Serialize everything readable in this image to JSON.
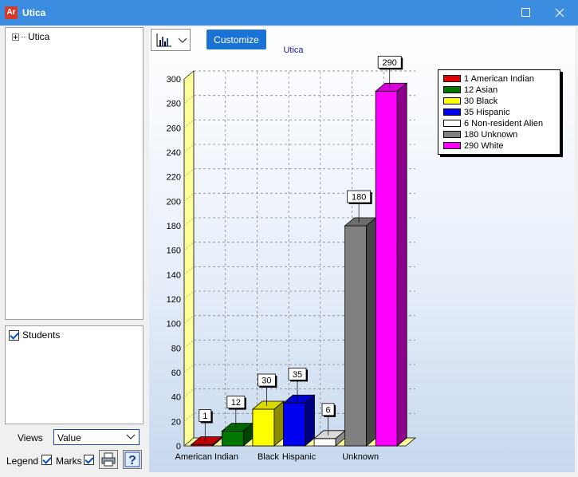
{
  "window": {
    "app_icon_label": "Ar",
    "title": "Utica",
    "icons": [
      "maximize-icon",
      "close-icon"
    ]
  },
  "tree": {
    "root": "Utica"
  },
  "list": {
    "items": [
      {
        "label": "Students",
        "checked": true
      }
    ]
  },
  "views": {
    "label": "Views",
    "value": "Value"
  },
  "legend_row": {
    "legend_label": "Legend",
    "marks_label": "Marks",
    "legend_checked": true,
    "marks_checked": true,
    "icons": [
      "printer-icon",
      "help-icon"
    ]
  },
  "toolbar": {
    "chart_type_icon": "bar-chart-icon",
    "customize_label": "Customize"
  },
  "colors": {
    "titlebar": "#3c8de0",
    "accent": "#1a72d4"
  },
  "chart_data": {
    "type": "bar",
    "title": "Utica",
    "categories": [
      "American Indian",
      "Asian",
      "Black",
      "Hispanic",
      "Non-resident Alien",
      "Unknown",
      "White"
    ],
    "values": [
      1,
      12,
      30,
      35,
      6,
      180,
      290
    ],
    "colors": [
      "#e00000",
      "#007800",
      "#ffff00",
      "#0000f0",
      "#ffffff",
      "#808080",
      "#ff00ff"
    ],
    "x_tick_labels": [
      "American Indian",
      "Black",
      "Hispanic",
      "Unknown"
    ],
    "x_tick_categories": [
      0,
      2,
      3,
      5
    ],
    "ylim": [
      0,
      300
    ],
    "ytick_step": 20,
    "grid": true,
    "legend_position": "right",
    "legend_entries": [
      "1 American Indian",
      "12 Asian",
      "30 Black",
      "35 Hispanic",
      "6 Non-resident Alien",
      "180 Unknown",
      "290 White"
    ]
  }
}
